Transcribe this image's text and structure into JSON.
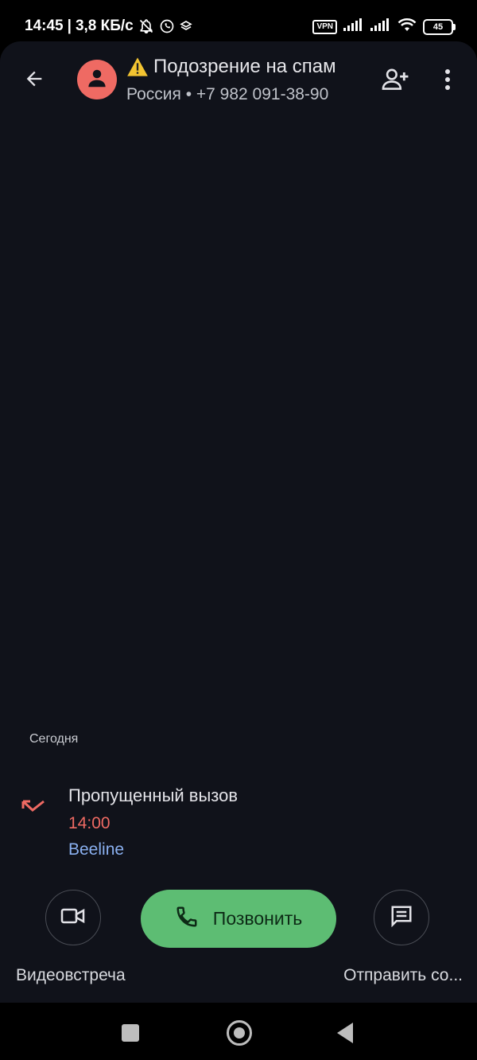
{
  "status_bar": {
    "time": "14:45",
    "separator": "|",
    "speed": "3,8 КБ/с",
    "vpn": "VPN",
    "battery": "45"
  },
  "header": {
    "title": "Подозрение на спам",
    "subtitle": "Россия • +7 982 091-38-90"
  },
  "history": {
    "section": "Сегодня",
    "entries": [
      {
        "type": "Пропущенный вызов",
        "time": "14:00",
        "carrier": "Beeline"
      }
    ]
  },
  "actions": {
    "video_label": "Видеовстреча",
    "call_label": "Позвонить",
    "message_label": "Отправить со..."
  },
  "colors": {
    "background": "#10121a",
    "avatar": "#ef6a63",
    "missed": "#ef6a63",
    "carrier": "#8ab0f0",
    "call_button": "#5dbd73"
  },
  "icons": {
    "back": "arrow-back-icon",
    "avatar": "person-icon",
    "warning": "warning-icon",
    "add_contact": "person-add-icon",
    "more": "more-vert-icon",
    "missed": "missed-call-icon",
    "video": "videocam-icon",
    "phone": "phone-icon",
    "message": "message-icon"
  }
}
